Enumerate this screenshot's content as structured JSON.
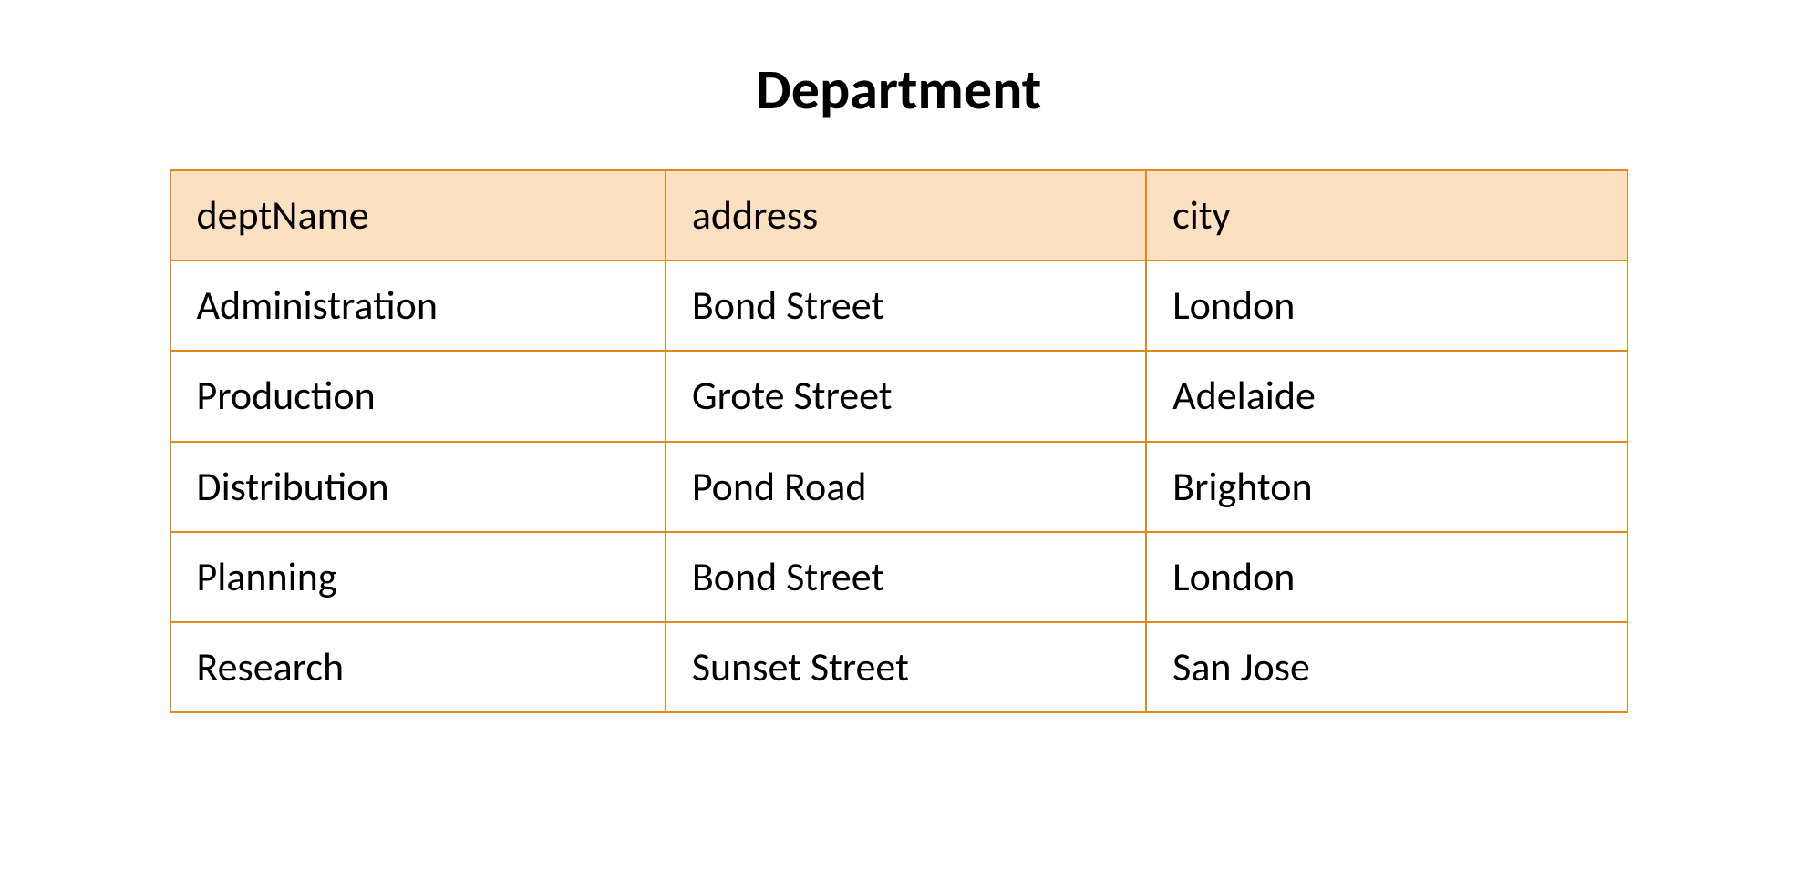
{
  "title": "Department",
  "colors": {
    "border": "#e08a1e",
    "header_fill": "#fbe0c1"
  },
  "table": {
    "columns": [
      "deptName",
      "address",
      "city"
    ],
    "rows": [
      {
        "deptName": "Administration",
        "address": "Bond Street",
        "city": "London"
      },
      {
        "deptName": "Production",
        "address": "Grote Street",
        "city": "Adelaide"
      },
      {
        "deptName": "Distribution",
        "address": "Pond Road",
        "city": "Brighton"
      },
      {
        "deptName": "Planning",
        "address": "Bond Street",
        "city": "London"
      },
      {
        "deptName": "Research",
        "address": "Sunset Street",
        "city": "San Jose"
      }
    ]
  },
  "chart_data": {
    "type": "table",
    "title": "Department",
    "columns": [
      "deptName",
      "address",
      "city"
    ],
    "rows": [
      [
        "Administration",
        "Bond Street",
        "London"
      ],
      [
        "Production",
        "Grote Street",
        "Adelaide"
      ],
      [
        "Distribution",
        "Pond Road",
        "Brighton"
      ],
      [
        "Planning",
        "Bond Street",
        "London"
      ],
      [
        "Research",
        "Sunset Street",
        "San Jose"
      ]
    ]
  }
}
